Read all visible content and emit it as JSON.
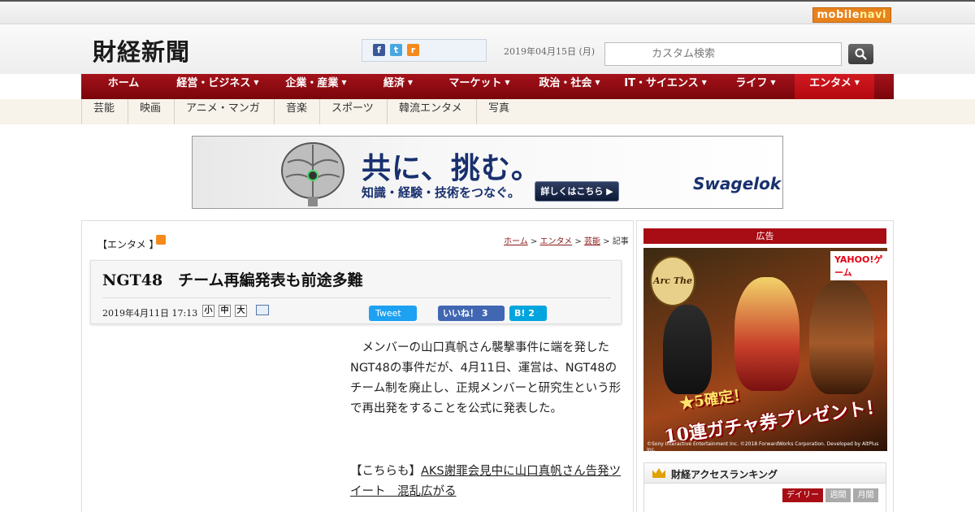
{
  "topbar": {
    "mobile_brand_a": "mobile",
    "mobile_brand_b": "navi"
  },
  "header": {
    "logo": "財経新聞",
    "date": "2019年04月15日 (月)",
    "search_placeholder": "カスタム検索",
    "social": {
      "facebook": "f",
      "twitter": "t",
      "rss": "r"
    }
  },
  "nav": {
    "items": [
      {
        "label": "ホーム"
      },
      {
        "label": "経営・ビジネス"
      },
      {
        "label": "企業・産業"
      },
      {
        "label": "経済"
      },
      {
        "label": "マーケット"
      },
      {
        "label": "政治・社会"
      },
      {
        "label": "IT・サイエンス"
      },
      {
        "label": "ライフ"
      },
      {
        "label": "エンタメ"
      }
    ],
    "caret": "▼"
  },
  "subnav": {
    "items": [
      "芸能",
      "映画",
      "アニメ・マンガ",
      "音楽",
      "スポーツ",
      "韓流エンタメ",
      "写真"
    ]
  },
  "banner": {
    "headline": "共に、挑む。",
    "sub": "知識・経験・技術をつなぐ。",
    "cta": "詳しくはこちら ▶",
    "brand": "Swagelok"
  },
  "article": {
    "category": "【エンタメ 】",
    "breadcrumb": {
      "home": "ホーム",
      "sep": ">",
      "cat": "エンタメ",
      "sub": "芸能",
      "current": "記事"
    },
    "title": "NGT48　チーム再編発表も前途多難",
    "published": "2019年4月11日 17:13",
    "font_sizes": [
      "小",
      "中",
      "大"
    ],
    "tweet": "Tweet",
    "like": "いいね！ 3",
    "hatena": "B! 2",
    "body": "　メンバーの山口真帆さん襲撃事件に端を発したNGT48の事件だが、4月11日、運営は、NGT48のチーム制を廃止し、正規メンバーと研究生という形で再出発をすることを公式に発表した。",
    "related_prefix": "【こちらも】",
    "related_link": "AKS謝罪会見中に山口真帆さん告発ツイート　混乱広がる"
  },
  "sidebar": {
    "ad_label": "広告",
    "ad": {
      "game_logo": "Arc The Lad",
      "network": "YAHOO!ゲーム",
      "copy1": "★5確定！",
      "copy2": "10連ガチャ券プレゼント！",
      "fine": "©Sony Interactive Entertainment Inc. ©2018 ForwardWorks Corporation. Developed by AltPlus Inc."
    },
    "ranking": {
      "title": "財経アクセスランキング",
      "tabs": [
        "デイリー",
        "週間",
        "月間"
      ]
    }
  },
  "colors": {
    "nav_red": "#a5121a",
    "active_red": "#d21a22",
    "link_red": "#8b1a1a"
  }
}
